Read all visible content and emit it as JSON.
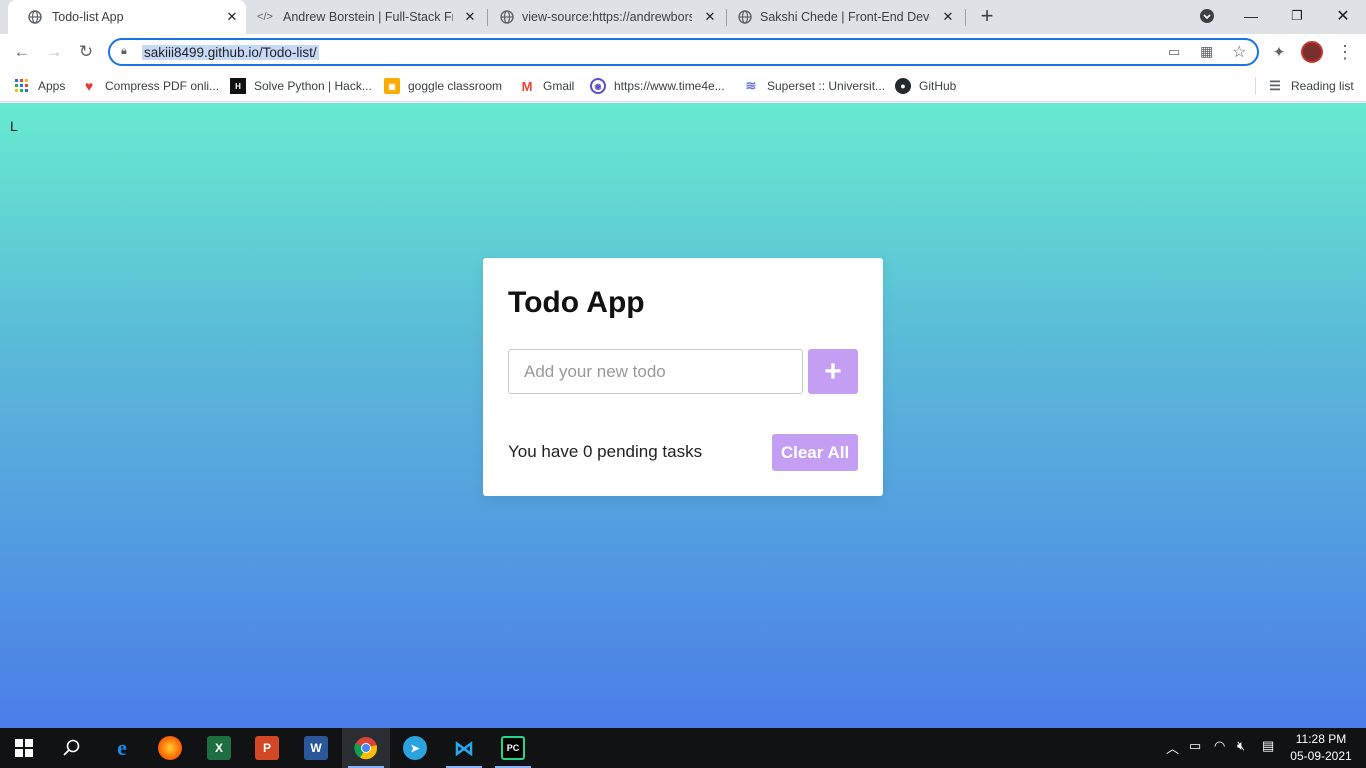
{
  "browser": {
    "tabs": [
      {
        "label": "Todo-list App",
        "icon": "globe-icon"
      },
      {
        "label": "Andrew Borstein | Full-Stack Fron",
        "icon": "code-icon"
      },
      {
        "label": "view-source:https://andrewborst",
        "icon": "globe-icon"
      },
      {
        "label": "Sakshi Chede | Front-End Develo",
        "icon": "globe-icon"
      }
    ],
    "url": "sakiii8499.github.io/Todo-list/",
    "bookmarks": [
      {
        "label": "Apps",
        "icon": "apps-grid-icon"
      },
      {
        "label": "Compress PDF onli...",
        "icon": "heart-icon"
      },
      {
        "label": "Solve Python | Hack...",
        "icon": "hackerrank-icon"
      },
      {
        "label": "goggle classroom",
        "icon": "classroom-icon"
      },
      {
        "label": "Gmail",
        "icon": "gmail-icon"
      },
      {
        "label": "https://www.time4e...",
        "icon": "time4e-icon"
      },
      {
        "label": "Superset :: Universit...",
        "icon": "superset-icon"
      },
      {
        "label": "GitHub",
        "icon": "github-icon"
      }
    ],
    "reading_list": "Reading list"
  },
  "page": {
    "stray_char": "L",
    "title": "Todo App",
    "input_placeholder": "Add your new todo",
    "add_label": "+",
    "pending_text": "You have 0 pending tasks",
    "clear_label": "Clear All"
  },
  "taskbar": {
    "apps": [
      "start-icon",
      "search-icon",
      "edge-icon",
      "firefox-icon",
      "excel-icon",
      "powerpoint-icon",
      "word-icon",
      "chrome-icon",
      "telegram-icon",
      "vscode-icon",
      "pycharm-icon"
    ],
    "time": "11:28 PM",
    "date": "05-09-2021"
  },
  "colors": {
    "accent": "#c49ef2",
    "gradient_top": "#67ead0",
    "gradient_bottom": "#4b7ee8"
  }
}
